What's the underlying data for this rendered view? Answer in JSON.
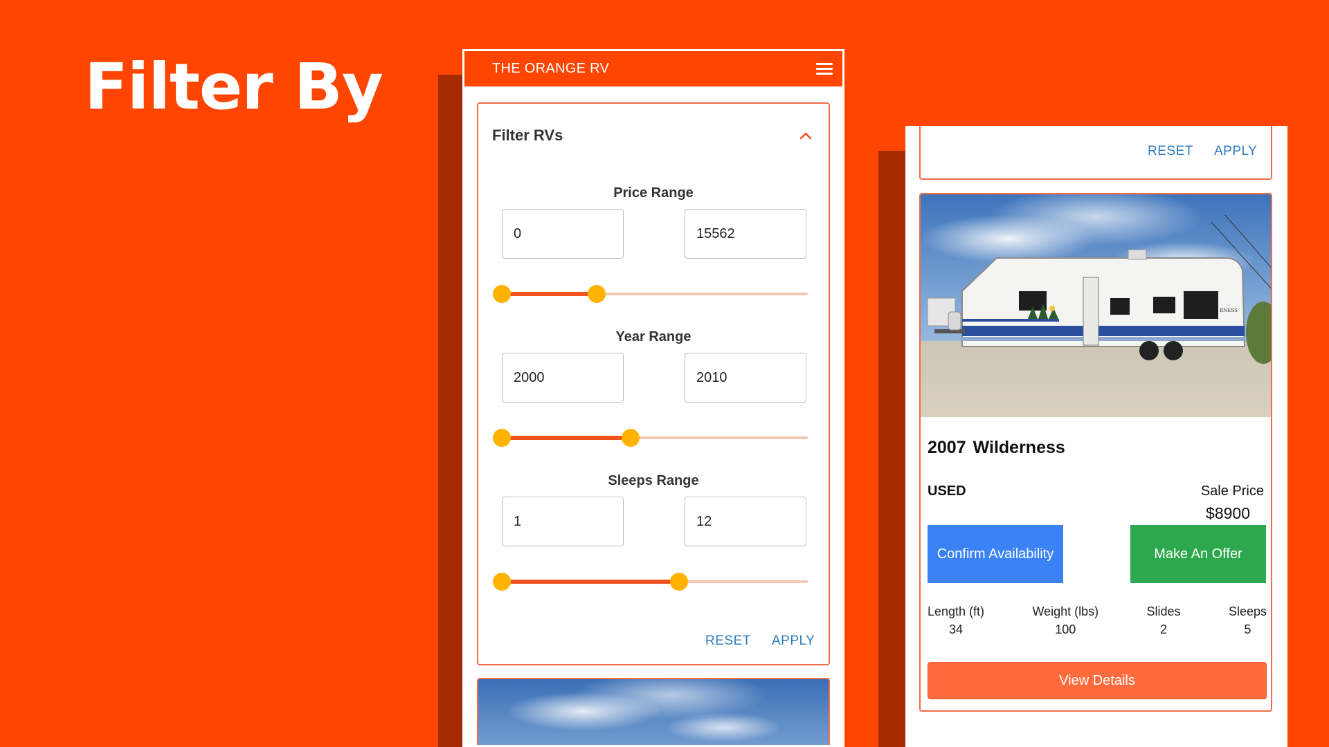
{
  "hero": {
    "title": "Filter By"
  },
  "app": {
    "title": "THE ORANGE RV"
  },
  "filter": {
    "title": "Filter RVs",
    "price": {
      "label": "Price Range",
      "min": "0",
      "max": "15562",
      "slider_low": 0.0,
      "slider_high": 0.31
    },
    "year": {
      "label": "Year Range",
      "min": "2000",
      "max": "2010",
      "slider_low": 0.0,
      "slider_high": 0.42
    },
    "sleeps": {
      "label": "Sleeps Range",
      "min": "1",
      "max": "12",
      "slider_low": 0.0,
      "slider_high": 0.58
    },
    "reset_label": "RESET",
    "apply_label": "APPLY"
  },
  "listing": {
    "year": "2007",
    "name": "Wilderness",
    "condition": "USED",
    "sale_label": "Sale Price",
    "sale_price": "$8900",
    "confirm_label": "Confirm Availability",
    "offer_label": "Make An Offer",
    "specs": [
      {
        "label": "Length (ft)",
        "value": "34"
      },
      {
        "label": "Weight (lbs)",
        "value": "100"
      },
      {
        "label": "Slides",
        "value": "2"
      },
      {
        "label": "Sleeps",
        "value": "5"
      }
    ],
    "details_label": "View Details",
    "trailer_brand": "RNESS"
  },
  "colors": {
    "background": "#FF4500",
    "accent": "#F1531E",
    "thumb": "#FFB300",
    "link": "#2C7BBF",
    "confirm": "#3B82F6",
    "offer": "#2DA84E",
    "details": "#FF6B3D"
  }
}
